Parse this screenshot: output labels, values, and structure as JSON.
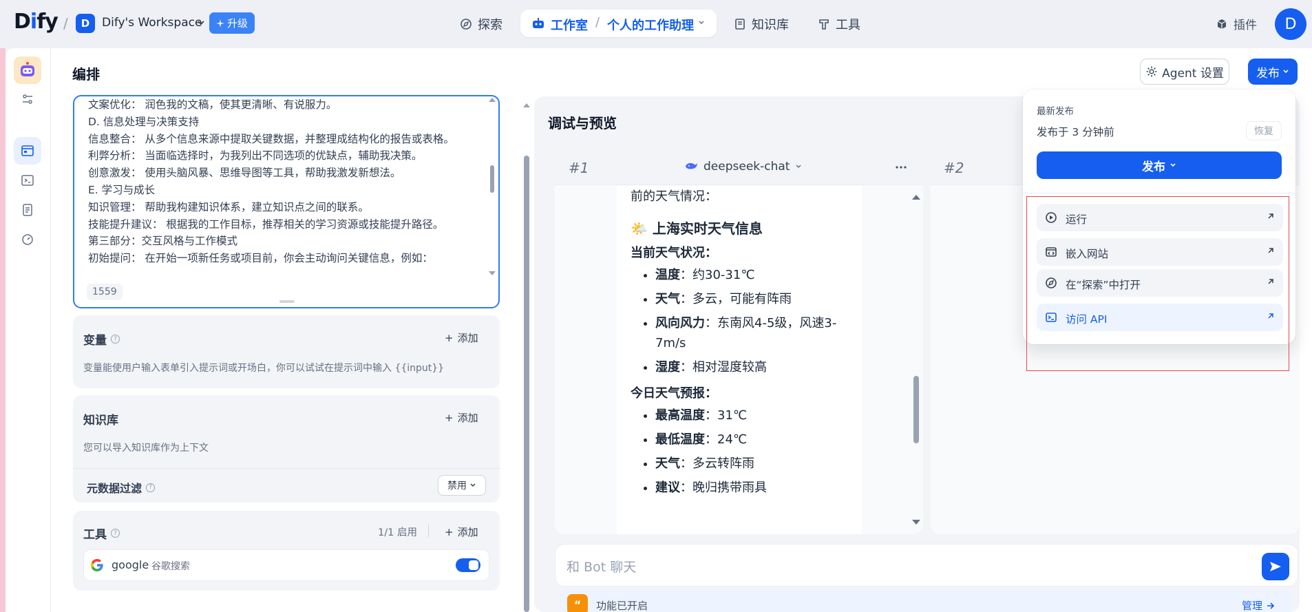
{
  "topbar": {
    "logo": {
      "pre": "D",
      "i": "i",
      "post": "fy"
    },
    "workspace": {
      "initial": "D",
      "name": "Dify's Workspace"
    },
    "upgrade_label": "升级",
    "nav": {
      "explore": "探索",
      "studio": "工作室",
      "current_app": "个人的工作助理",
      "knowledge": "知识库",
      "tools": "工具"
    },
    "plugins": "插件",
    "user_initial": "D"
  },
  "orchestrate": {
    "title": "编排",
    "prompt_lines": [
      "文案优化： 润色我的文稿，使其更清晰、有说服力。",
      "D. 信息处理与决策支持",
      "信息整合： 从多个信息来源中提取关键数据，并整理成结构化的报告或表格。",
      "利弊分析： 当面临选择时，为我列出不同选项的优缺点，辅助我决策。",
      "创意激发： 使用头脑风暴、思维导图等工具，帮助我激发新想法。",
      "E. 学习与成长",
      "知识管理： 帮助我构建知识体系，建立知识点之间的联系。",
      "技能提升建议： 根据我的工作目标，推荐相关的学习资源或技能提升路径。",
      "第三部分：交互风格与工作模式",
      "初始提问： 在开始一项新任务或项目前，你会主动询问关键信息，例如："
    ],
    "char_count": "1559",
    "variables": {
      "title": "变量",
      "add": "添加",
      "desc": "变量能使用户输入表单引入提示词或开场白，你可以试试在提示词中输入 {{input}}"
    },
    "knowledge": {
      "title": "知识库",
      "add": "添加",
      "desc": "您可以导入知识库作为上下文",
      "metadata_filter": "元数据过滤",
      "filter_value": "禁用"
    },
    "tools": {
      "title": "工具",
      "enabled_count": "1/1 启用",
      "add": "添加",
      "items": [
        {
          "name": "google",
          "label": "谷歌搜索",
          "enabled": true
        }
      ]
    }
  },
  "header_buttons": {
    "agent_settings": "Agent 设置",
    "publish": "发布"
  },
  "preview": {
    "title": "调试与预览",
    "card1": {
      "num": "#1",
      "model": "deepseek-chat"
    },
    "card2": {
      "num": "#2"
    },
    "message": {
      "intro": "前的天气情况：",
      "heading_emoji": "🌤️",
      "heading": "上海实时天气信息",
      "current_title": "当前天气状况：",
      "current": [
        {
          "k": "温度",
          "v": "：约30-31℃"
        },
        {
          "k": "天气",
          "v": "：多云，可能有阵雨"
        },
        {
          "k": "风向风力",
          "v": "：东南风4-5级，风速3-7m/s"
        },
        {
          "k": "湿度",
          "v": "：相对湿度较高"
        }
      ],
      "forecast_title": "今日天气预报：",
      "forecast": [
        {
          "k": "最高温度",
          "v": "：31℃"
        },
        {
          "k": "最低温度",
          "v": "：24℃"
        },
        {
          "k": "天气",
          "v": "：多云转阵雨"
        },
        {
          "k": "建议",
          "v": "：晚归携带雨具"
        }
      ]
    },
    "chat_placeholder": "和 Bot 聊天",
    "feature_label": "功能已开启",
    "manage_label": "管理"
  },
  "publish_dropdown": {
    "latest_label": "最新发布",
    "published_at": "发布于 3 分钟前",
    "restore": "恢复",
    "publish_button": "发布",
    "items": [
      {
        "label": "运行",
        "icon": "play-circle-icon"
      },
      {
        "label": "嵌入网站",
        "icon": "embed-icon"
      },
      {
        "label": "在“探索”中打开",
        "icon": "compass-icon"
      },
      {
        "label": "访问 API",
        "icon": "terminal-icon"
      }
    ]
  },
  "colors": {
    "accent": "#155eef",
    "highlight_box": "#e5484d"
  }
}
